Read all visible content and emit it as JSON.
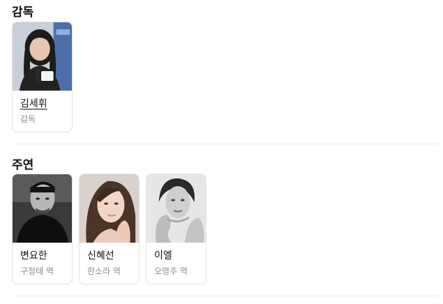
{
  "sections": [
    {
      "title": "감독",
      "people": [
        {
          "name": "김세휘",
          "role": "감독",
          "photo": "director-photo"
        }
      ]
    },
    {
      "title": "주연",
      "people": [
        {
          "name": "변요한",
          "role": "구정태 역",
          "photo": "actor-photo"
        },
        {
          "name": "신혜선",
          "role": "한소라 역",
          "photo": "actress-photo"
        },
        {
          "name": "이엘",
          "role": "오영주 역",
          "photo": "actress-photo"
        }
      ]
    }
  ]
}
